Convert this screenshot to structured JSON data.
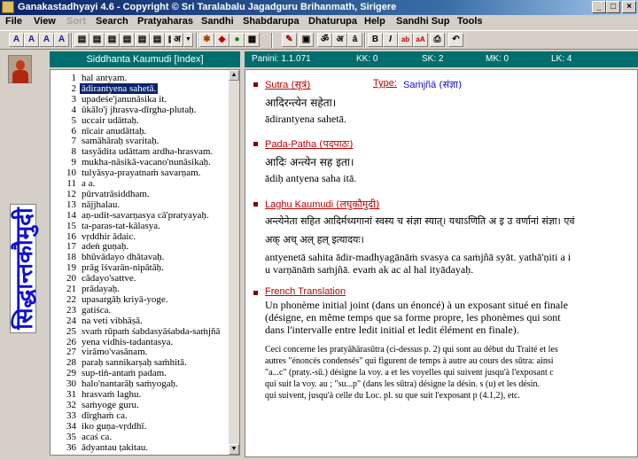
{
  "window": {
    "title": "Ganakastadhyayi 4.6 - Copyright © Sri Taralabalu Jagadguru Brihanmath, Sirigere"
  },
  "menu": [
    "File",
    "View",
    "Sort",
    "Search",
    "Pratyaharas",
    "Sandhi",
    "Shabdarupa",
    "Dhaturupa",
    "Help",
    "Sandhi Sup",
    "Tools"
  ],
  "toolbar_icons": [
    "a-icon",
    "a-icon",
    "a-icon",
    "a-icon",
    "book-icon",
    "book-icon",
    "book-icon",
    "book-icon",
    "book-icon",
    "book-icon",
    "book-icon",
    "script-icon",
    "dropdown-icon",
    "tool-icon",
    "tool-icon",
    "tool-icon",
    "tool-icon",
    "edit-icon",
    "save-icon",
    "om-icon",
    "aa-icon",
    "aa-dot-icon",
    "bold-icon",
    "italic-icon",
    "color-icon",
    "font-icon",
    "print-icon",
    "undo-icon"
  ],
  "left_strip": {
    "vertical_title": "सिद्धान्तकौमुदी"
  },
  "index": {
    "header": "Siddhanta Kaumudi  [Index]",
    "selected": 2,
    "rows": [
      {
        "n": "1",
        "t": "hal antyam."
      },
      {
        "n": "2",
        "t": "ādirantyena sahetā."
      },
      {
        "n": "3",
        "t": "upadeśe'janunāsika it."
      },
      {
        "n": "4",
        "t": "ūkālo'j jhrasva-dīrgha-plutaḥ."
      },
      {
        "n": "5",
        "t": "uccair udāttaḥ."
      },
      {
        "n": "6",
        "t": "nīcair anudāttaḥ."
      },
      {
        "n": "7",
        "t": "samāhāraḥ svaritaḥ."
      },
      {
        "n": "8",
        "t": "tasyādita udāttam ardha-hrasvam."
      },
      {
        "n": "9",
        "t": "mukha-nāsikā-vacano'nunāsikaḥ."
      },
      {
        "n": "10",
        "t": "tulyāsya-prayatnaṁ savarṇam."
      },
      {
        "n": "11",
        "t": "a a."
      },
      {
        "n": "12",
        "t": "pūrvatrāsiddham."
      },
      {
        "n": "13",
        "t": "nājjhalau."
      },
      {
        "n": "14",
        "t": "aṇ-udit-savarṇasya cā'pratyayaḥ."
      },
      {
        "n": "15",
        "t": "ta-paras-tat-kālasya."
      },
      {
        "n": "16",
        "t": "vṛddhir ādaic."
      },
      {
        "n": "17",
        "t": "adeṅ guṇaḥ."
      },
      {
        "n": "18",
        "t": "bhūvādayo dhātavaḥ."
      },
      {
        "n": "19",
        "t": "prāg īśvarān-nipātāḥ."
      },
      {
        "n": "20",
        "t": "cādayo'sattve."
      },
      {
        "n": "21",
        "t": "prādayaḥ."
      },
      {
        "n": "22",
        "t": "upasargāḥ kriyā-yoge."
      },
      {
        "n": "23",
        "t": "gatiśca."
      },
      {
        "n": "24",
        "t": "na veti vibhāṣā."
      },
      {
        "n": "25",
        "t": "svaṁ rūpaṁ śabdasyāśabda-saṁjñā"
      },
      {
        "n": "26",
        "t": "yena vidhis-tadantasya."
      },
      {
        "n": "27",
        "t": "virāmo'vasānam."
      },
      {
        "n": "28",
        "t": "paraḥ sannikarṣaḥ saṁhitā."
      },
      {
        "n": "29",
        "t": "sup-tiṅ-antaṁ padam."
      },
      {
        "n": "30",
        "t": "halo'nantarāḥ saṁyogaḥ."
      },
      {
        "n": "31",
        "t": "hrasvaṁ laghu."
      },
      {
        "n": "32",
        "t": "saṁyoge guru."
      },
      {
        "n": "33",
        "t": "dīrghaṁ ca."
      },
      {
        "n": "34",
        "t": "iko guṇa-vṛddhī."
      },
      {
        "n": "35",
        "t": "acaś ca."
      },
      {
        "n": "36",
        "t": "ādyantau ṭakitau."
      }
    ]
  },
  "info": {
    "panini": "Panini: 1.1.071",
    "kk": "KK: 0",
    "sk": "SK: 2",
    "mk": "MK: 0",
    "lk": "LK: 4"
  },
  "content": {
    "sutra_label": "Sutra",
    "sutra_label_dev": "(सूत्रं)",
    "type_label": "Type:",
    "type_value": "Saṁjñā",
    "type_value_dev": "(संज्ञा)",
    "sutra_dev": "आदिरन्त्येन सहेता।",
    "sutra_translit": "ādirantyena sahetā.",
    "padapatha_label": "Pada-Patha",
    "padapatha_label_dev": "(पदपाठः)",
    "padapatha_dev": "आदिः अन्त्येन सह इता।",
    "padapatha_translit": "ādiḥ antyena saha itā.",
    "laghu_label": "Laghu Kaumudi",
    "laghu_label_dev": "(लघुकौमुदी)",
    "laghu_dev_1": "अन्त्येनेता सहित आदिर्मध्यगानां स्वस्य च संज्ञा स्यात्। यथाऽणिति अ इ उ वर्णानां संज्ञा। एवं",
    "laghu_dev_2": "अक् अच् अल् हल् इत्यादयः।",
    "laghu_translit_1": "antyenetā sahita ādir-madhyagānāṁ svasya ca saṁjñā syāt.  yathā'ṇiti a i",
    "laghu_translit_2": "u varṇānāṁ saṁjñā.  evaṁ ak  ac  al  hal  ityādayaḥ.",
    "french_label": "French Translation",
    "french_1": "Un phonème initial joint (dans un énoncé) à un exposant situé en finale",
    "french_2": "(désigne, en même temps que sa forme propre, les phonèmes qui sont",
    "french_3": "dans l'intervalle entre ledit initial et ledit élément en finale).",
    "note_1": "Ceci concerne les pratyāhārasūtra (ci-dessus p. 2) qui sont au début du Traité et les",
    "note_2": "autres \"énoncés condensés\" qui figurent de temps à autre au cours des sūtra: ainsi",
    "note_3": "\"a...c\" (praty.-sū.) désigne la voy. a et les voyelles qui suivent jusqu'à l'exposant c",
    "note_4": "qui suit la voy. au ; \"su...p\" (dans les sūtra) désigne la désin. s (u) et les désin.",
    "note_5": "qui suivent, jusqu'à celle du Loc. pl. su que suit l'exposant p (4.1,2), etc."
  },
  "colors": {
    "title_bar": "#0a246a",
    "panel_header": "#006e6e",
    "selection": "#0a246a",
    "section_heading": "#c00000",
    "devanagari_accent": "#1010d0"
  }
}
